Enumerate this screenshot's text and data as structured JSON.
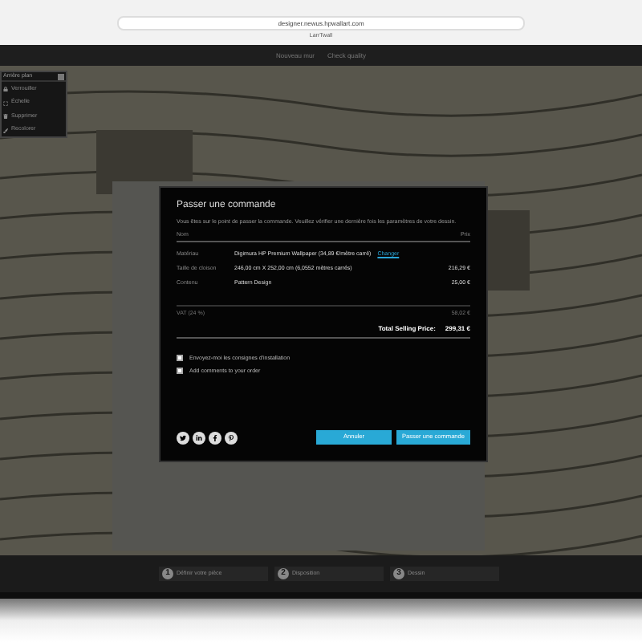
{
  "browser": {
    "address": "designer.newus.hpwallart.com",
    "tab_title": "LarrTwall"
  },
  "top_nav": [
    {
      "label": "Nouveau mur"
    },
    {
      "label": "Check quality"
    }
  ],
  "left_panel": {
    "title": "Arrière plan",
    "items": [
      {
        "label": "Verrouiller"
      },
      {
        "label": "Échelle"
      },
      {
        "label": "Supprimer"
      },
      {
        "label": "Recolorer"
      }
    ]
  },
  "modal": {
    "title": "Passer une commande",
    "intro": "Vous êtes sur le point de passer la commande. Veuillez vérifier une dernière fois les paramètres de votre dessin.",
    "columns": [
      "Nom",
      "Prix"
    ],
    "rows": [
      {
        "name": "Matériau",
        "value": "Digimura HP Premium Wallpaper  (34,89 €/mètre carré)",
        "link": "Changer"
      },
      {
        "name": "Taille de cloison",
        "value": "246,00 cm  X  252,00 cm  (6,0552 mètres carrés)",
        "price": "216,29 €"
      },
      {
        "name": "Contenu",
        "value": "Pattern Design",
        "price": "25,00 €"
      }
    ],
    "vat": {
      "label": "VAT (24 %)",
      "price": "58,02 €"
    },
    "total": {
      "label": "Total Selling Price:",
      "price": "299,31 €"
    },
    "options": [
      {
        "label": "Envoyez-moi les consignes d'installation",
        "checked": false
      },
      {
        "label": "Add comments to your order",
        "checked": false
      }
    ],
    "social": [
      {
        "kind": "twitter"
      },
      {
        "kind": "linkedin"
      },
      {
        "kind": "facebook"
      },
      {
        "kind": "pinterest"
      }
    ],
    "buttons": [
      {
        "label": "Annuler"
      },
      {
        "label": "Passer une commande"
      }
    ]
  },
  "steps": [
    {
      "number": "1",
      "label": "Définir votre pièce"
    },
    {
      "number": "2",
      "label": "Disposition"
    },
    {
      "number": "3",
      "label": "Dessin"
    }
  ]
}
